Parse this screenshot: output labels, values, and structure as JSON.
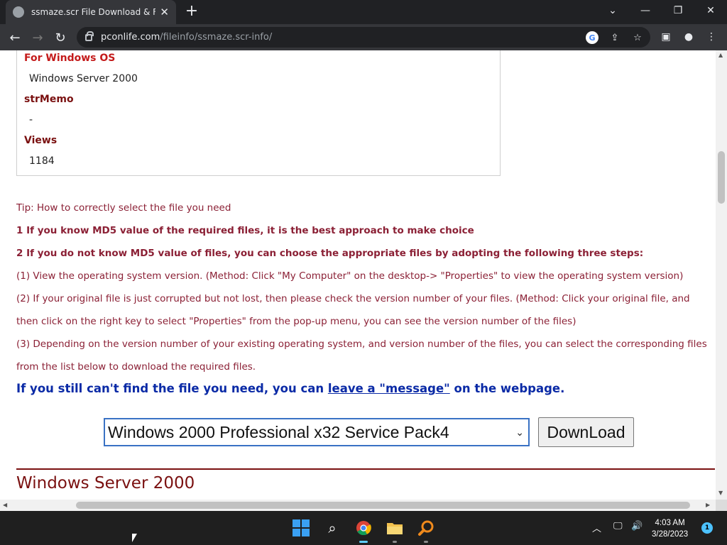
{
  "browser": {
    "tab_title": "ssmaze.scr File Download & Fix F",
    "url_host": "pconlife.com",
    "url_path": "/fileinfo/ssmaze.scr-info/"
  },
  "info": {
    "os_label": "For Windows OS",
    "os_value": "Windows Server 2000",
    "memo_label": "strMemo",
    "memo_value": "-",
    "views_label": "Views",
    "views_value": "1184"
  },
  "tips": {
    "title": "Tip: How to correctly select the file you need",
    "line1": "1 If you know MD5 value of the required files, it is the best approach to make choice",
    "line2": "2 If you do not know MD5 value of files, you can choose the appropriate files by adopting the following three steps:",
    "step1": " (1) View the operating system version. (Method: Click \"My Computer\" on the desktop-> \"Properties\" to view the operating system version)",
    "step2a": " (2) If your original file is just corrupted but not lost, then please check the version number of your files. (Method: Click your original file, and",
    "step2b": "then click on the right key to select \"Properties\" from the pop-up menu, you can see the version number of the files)",
    "step3a": " (3) Depending on the version number of your existing operating system, and version number of the files, you can select the corresponding files",
    "step3b": "from the list below to download the required files."
  },
  "help": {
    "prefix": "If you still can't find the file you need, you can ",
    "link": "leave a \"message\"",
    "suffix": " on the webpage."
  },
  "download": {
    "selected_os": "Windows 2000 Professional x32 Service Pack4",
    "button_label": "DownLoad"
  },
  "section": {
    "title": "Windows Server 2000"
  },
  "taskbar": {
    "time": "4:03 AM",
    "date": "3/28/2023",
    "notification_count": "1"
  }
}
